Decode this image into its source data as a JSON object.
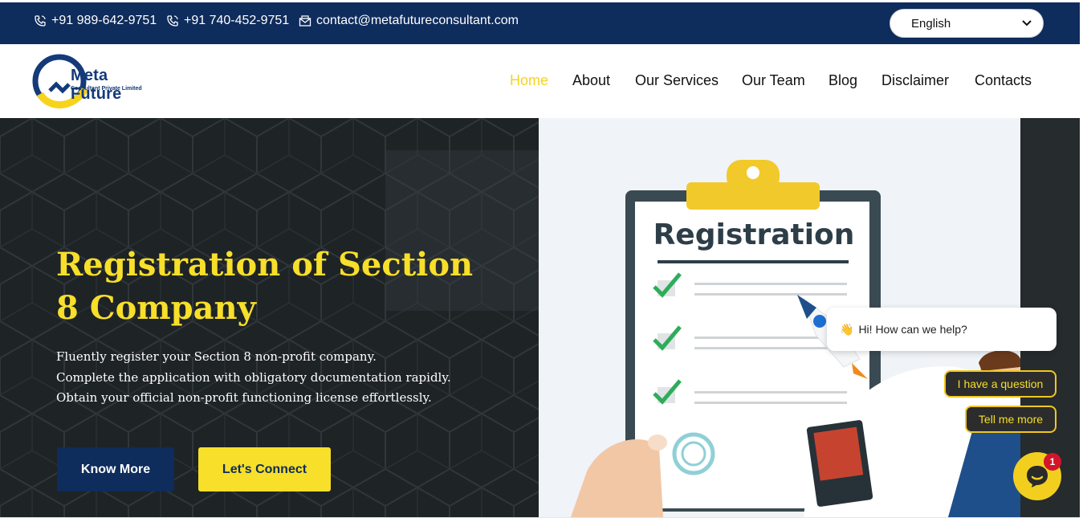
{
  "topbar": {
    "phone1": "+91 989-642-9751",
    "phone2": "+91 740-452-9751",
    "email": "contact@metafutureconsultant.com",
    "language": "English",
    "icons": [
      "phone-icon",
      "phone-icon",
      "email-icon",
      "chevron-down-icon"
    ]
  },
  "logo": {
    "name": "Meta Future",
    "sub": "Consultant Private Limited"
  },
  "nav": {
    "items": [
      "Home",
      "About",
      "Our Services",
      "Our Team",
      "Blog",
      "Disclaimer",
      "Contacts"
    ],
    "active": "Home"
  },
  "hero": {
    "title_line1": "Registration of Section",
    "title_line2": "8 Company",
    "desc_line1": "Fluently register your Section 8 non-profit company.",
    "desc_line2": "Complete the application with obligatory documentation rapidly.",
    "desc_line3": "Obtain your official non-profit functioning license effortlessly.",
    "btn_know": "Know More",
    "btn_connect": "Let's Connect",
    "illustration_heading": "Registration"
  },
  "chat": {
    "greeting": "Hi! How can we help?",
    "greeting_emoji": "👋",
    "option1": "I have a question",
    "option2": "Tell me more",
    "badge": "1"
  },
  "colors": {
    "navy": "#0e2c5c",
    "yellow": "#f7df2a",
    "dark": "#22272a"
  }
}
